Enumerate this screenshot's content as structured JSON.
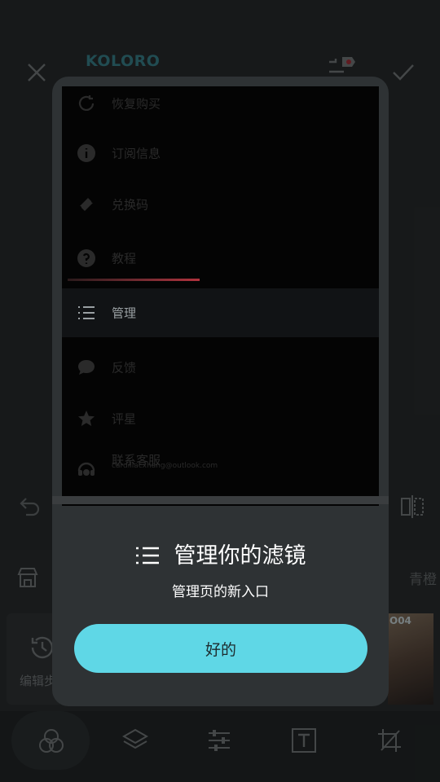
{
  "app": {
    "brand": "KOLORO",
    "bottom_right_label": "青橙",
    "left_panel_label": "编辑步",
    "thumbnail_label": "O04",
    "colors": {
      "accent": "#5fd7e6",
      "dialog_bg": "#2e3234",
      "brand": "#4bb8c9",
      "progress": "#b0323d"
    }
  },
  "toolbar": {
    "items": [
      {
        "icon": "filters-icon"
      },
      {
        "icon": "layers-icon"
      },
      {
        "icon": "adjust-sliders-icon"
      },
      {
        "icon": "text-icon"
      },
      {
        "icon": "crop-icon"
      }
    ]
  },
  "menu": {
    "items": [
      {
        "label": "恢复购买",
        "icon": "restore-icon"
      },
      {
        "label": "订阅信息",
        "icon": "info-icon"
      },
      {
        "label": "兑换码",
        "icon": "ticket-icon"
      },
      {
        "label": "教程",
        "icon": "help-icon"
      },
      {
        "label": "管理",
        "icon": "list-icon"
      },
      {
        "label": "反馈",
        "icon": "chat-icon"
      },
      {
        "label": "评星",
        "icon": "star-icon"
      },
      {
        "label": "联系客服",
        "icon": "support-icon",
        "sub": "cardillacxhang@outlook.com"
      }
    ]
  },
  "dialog": {
    "title": "管理你的滤镜",
    "subtitle": "管理页的新入口",
    "ok_label": "好的"
  }
}
